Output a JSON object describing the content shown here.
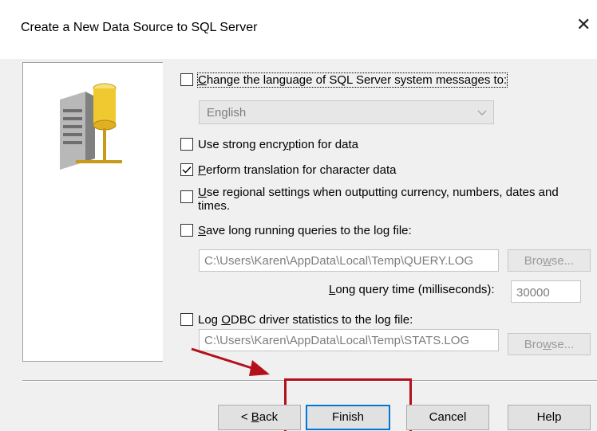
{
  "dialog": {
    "title": "Create a New Data Source to SQL Server",
    "close_glyph": "✕"
  },
  "options": {
    "change_language": {
      "before": "",
      "mnemonic": "C",
      "after": "hange the language of SQL Server system messages to:",
      "checked": false
    },
    "language_value": "English",
    "strong_encryption": {
      "before": "Use strong encr",
      "mnemonic": "y",
      "after": "ption for data",
      "checked": false
    },
    "translation": {
      "before": "",
      "mnemonic": "P",
      "after": "erform translation for character data",
      "checked": true
    },
    "regional": {
      "before": "",
      "mnemonic": "U",
      "after": "se regional settings when outputting currency, numbers, dates and times.",
      "checked": false
    },
    "long_queries": {
      "before": "",
      "mnemonic": "S",
      "after": "ave long running queries to the log file:",
      "checked": false
    },
    "query_log_path": "C:\\Users\\Karen\\AppData\\Local\\Temp\\QUERY.LOG",
    "query_time_label": {
      "before": "",
      "mnemonic": "L",
      "after": "ong query time (milliseconds):"
    },
    "query_time_value": "30000",
    "odbc_stats": {
      "before": "Log ",
      "mnemonic": "O",
      "after": "DBC driver statistics to the log file:",
      "checked": false
    },
    "stats_log_path": "C:\\Users\\Karen\\AppData\\Local\\Temp\\STATS.LOG"
  },
  "browse1": {
    "before": "Bro",
    "mnemonic": "w",
    "after": "se..."
  },
  "browse2": {
    "before": "Bro",
    "mnemonic": "w",
    "after": "se..."
  },
  "buttons": {
    "back": {
      "before": "< ",
      "mnemonic": "B",
      "after": "ack"
    },
    "finish": "Finish",
    "cancel": "Cancel",
    "help": "Help"
  },
  "colors": {
    "accent": "#0078d7",
    "annotation": "#b4101c"
  }
}
